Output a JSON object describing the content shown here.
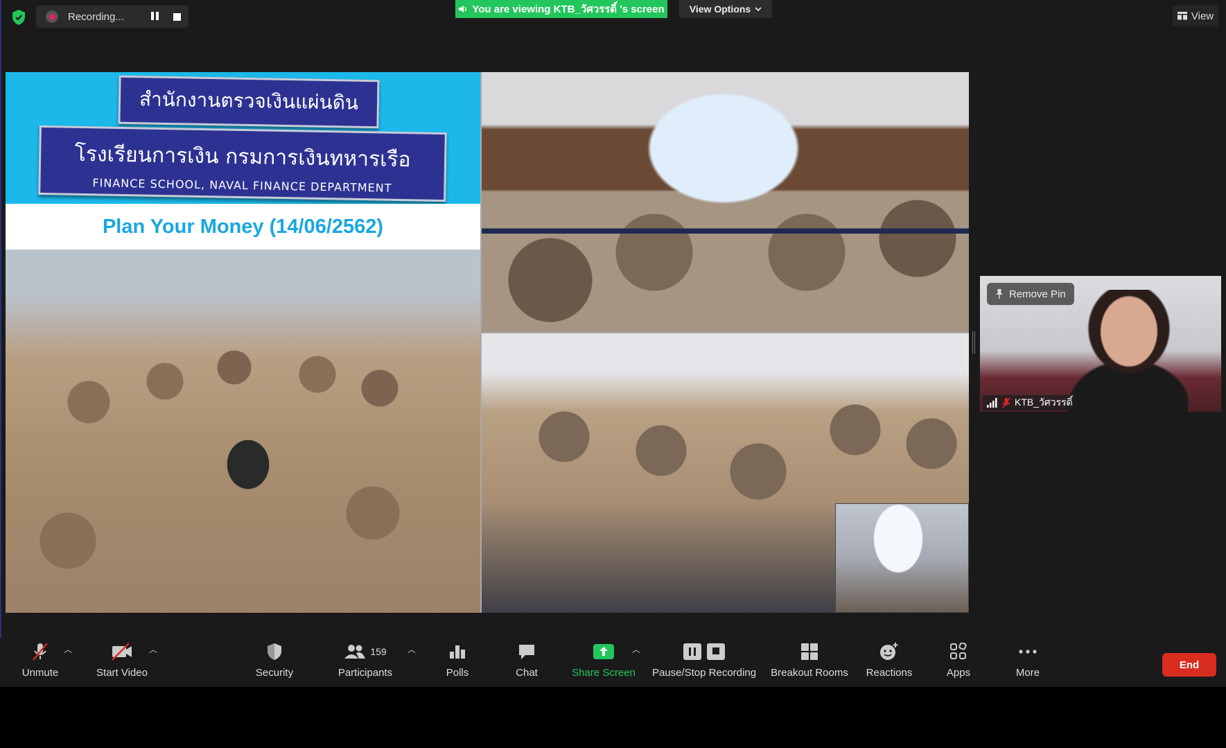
{
  "top_bar": {
    "recording_text": "Recording...",
    "viewing_banner": "You are viewing KTB_วัศวรรดิ์ 's screen",
    "view_options": "View Options",
    "view_button": "View"
  },
  "shared_screen": {
    "plate_line1": "สำนักงานตรวจเงินแผ่นดิน",
    "plate_line2": "โรงเรียนการเงิน กรมการเงินทหารเรือ",
    "plate_line3": "FINANCE SCHOOL, NAVAL FINANCE DEPARTMENT",
    "slide_title": "Plan Your Money (14/06/2562)"
  },
  "participant": {
    "remove_pin": "Remove Pin",
    "name": "KTB_วัศวรรดิ์"
  },
  "toolbar": {
    "unmute": "Unmute",
    "start_video": "Start Video",
    "security": "Security",
    "participants": "Participants",
    "participants_count": "159",
    "polls": "Polls",
    "chat": "Chat",
    "share_screen": "Share Screen",
    "pause_stop_recording": "Pause/Stop Recording",
    "breakout_rooms": "Breakout Rooms",
    "reactions": "Reactions",
    "apps": "Apps",
    "more": "More",
    "end": "End"
  },
  "colors": {
    "green_accent": "#23c65c",
    "end_red": "#d92d20",
    "slide_blue": "#1bb8e9"
  }
}
